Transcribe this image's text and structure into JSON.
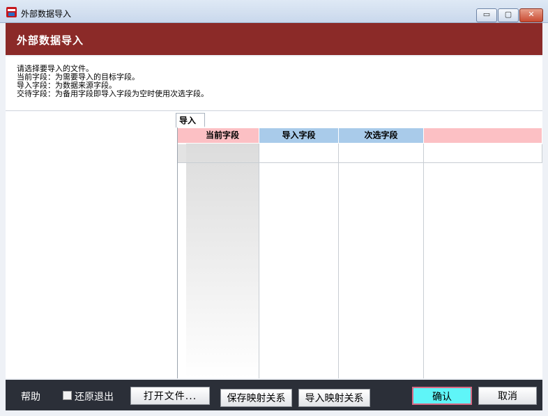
{
  "window": {
    "title": "外部数据导入",
    "controls": {
      "minimize": "▭",
      "maximize": "▢",
      "close": "✕"
    }
  },
  "header": {
    "title": "外部数据导入"
  },
  "info": {
    "lines": [
      "请选择要导入的文件。",
      "当前字段：为需要导入的目标字段。",
      "导入字段：为数据来源字段。",
      "交待字段：为备用字段即导入字段为空时使用次选字段。"
    ]
  },
  "tabs": [
    {
      "label": "导入"
    }
  ],
  "grid": {
    "columns": [
      "当前字段",
      "导入字段",
      "次选字段",
      ""
    ],
    "rows": [
      [
        "",
        "",
        "",
        ""
      ]
    ]
  },
  "footer": {
    "help_label": "帮助",
    "restore_exit_label": "还原退出",
    "restore_exit_checked": false,
    "open_file_label": "打开文件...",
    "save_mapping_label": "保存映射关系",
    "import_mapping_label": "导入映射关系",
    "confirm_label": "确认",
    "cancel_label": "取消"
  },
  "colors": {
    "header_bg": "#8b2a28",
    "footer_bg": "#2b2f38",
    "pink_header": "#fcc0c4",
    "blue_header": "#a9cbea",
    "confirm_bg": "#5ff5f8"
  }
}
